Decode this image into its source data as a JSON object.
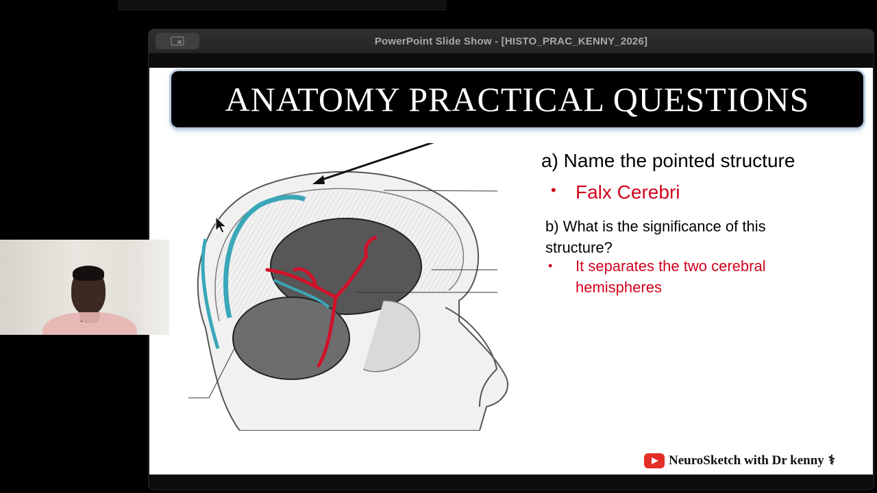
{
  "window": {
    "title": "PowerPoint Slide Show - [HISTO_PRAC_KENNY_2026]",
    "presenter_button_icon": "presenter-view-icon"
  },
  "slide": {
    "banner_title": "ANATOMY PRACTICAL QUESTIONS",
    "question_a": "a) Name the pointed structure",
    "answer_a_bullet": "•",
    "answer_a": "Falx Cerebri",
    "question_b": "b) What is the significance of this structure?",
    "answer_b_bullet": "•",
    "answer_b": "It separates the two cerebral hemispheres",
    "illustration_icon": "sagittal-head-section-illustration",
    "branding": {
      "logo_icon": "youtube-icon",
      "text": "NeuroSketch with Dr kenny",
      "symbol": "⚕"
    }
  },
  "webcam": {
    "icon": "presenter-webcam-feed"
  },
  "colors": {
    "answer_red": "#d0021b",
    "banner_black": "#000000",
    "titlebar_gray": "#2c2c2c",
    "vessel_blue": "#3aa7b8",
    "artery_red": "#d0122a"
  }
}
